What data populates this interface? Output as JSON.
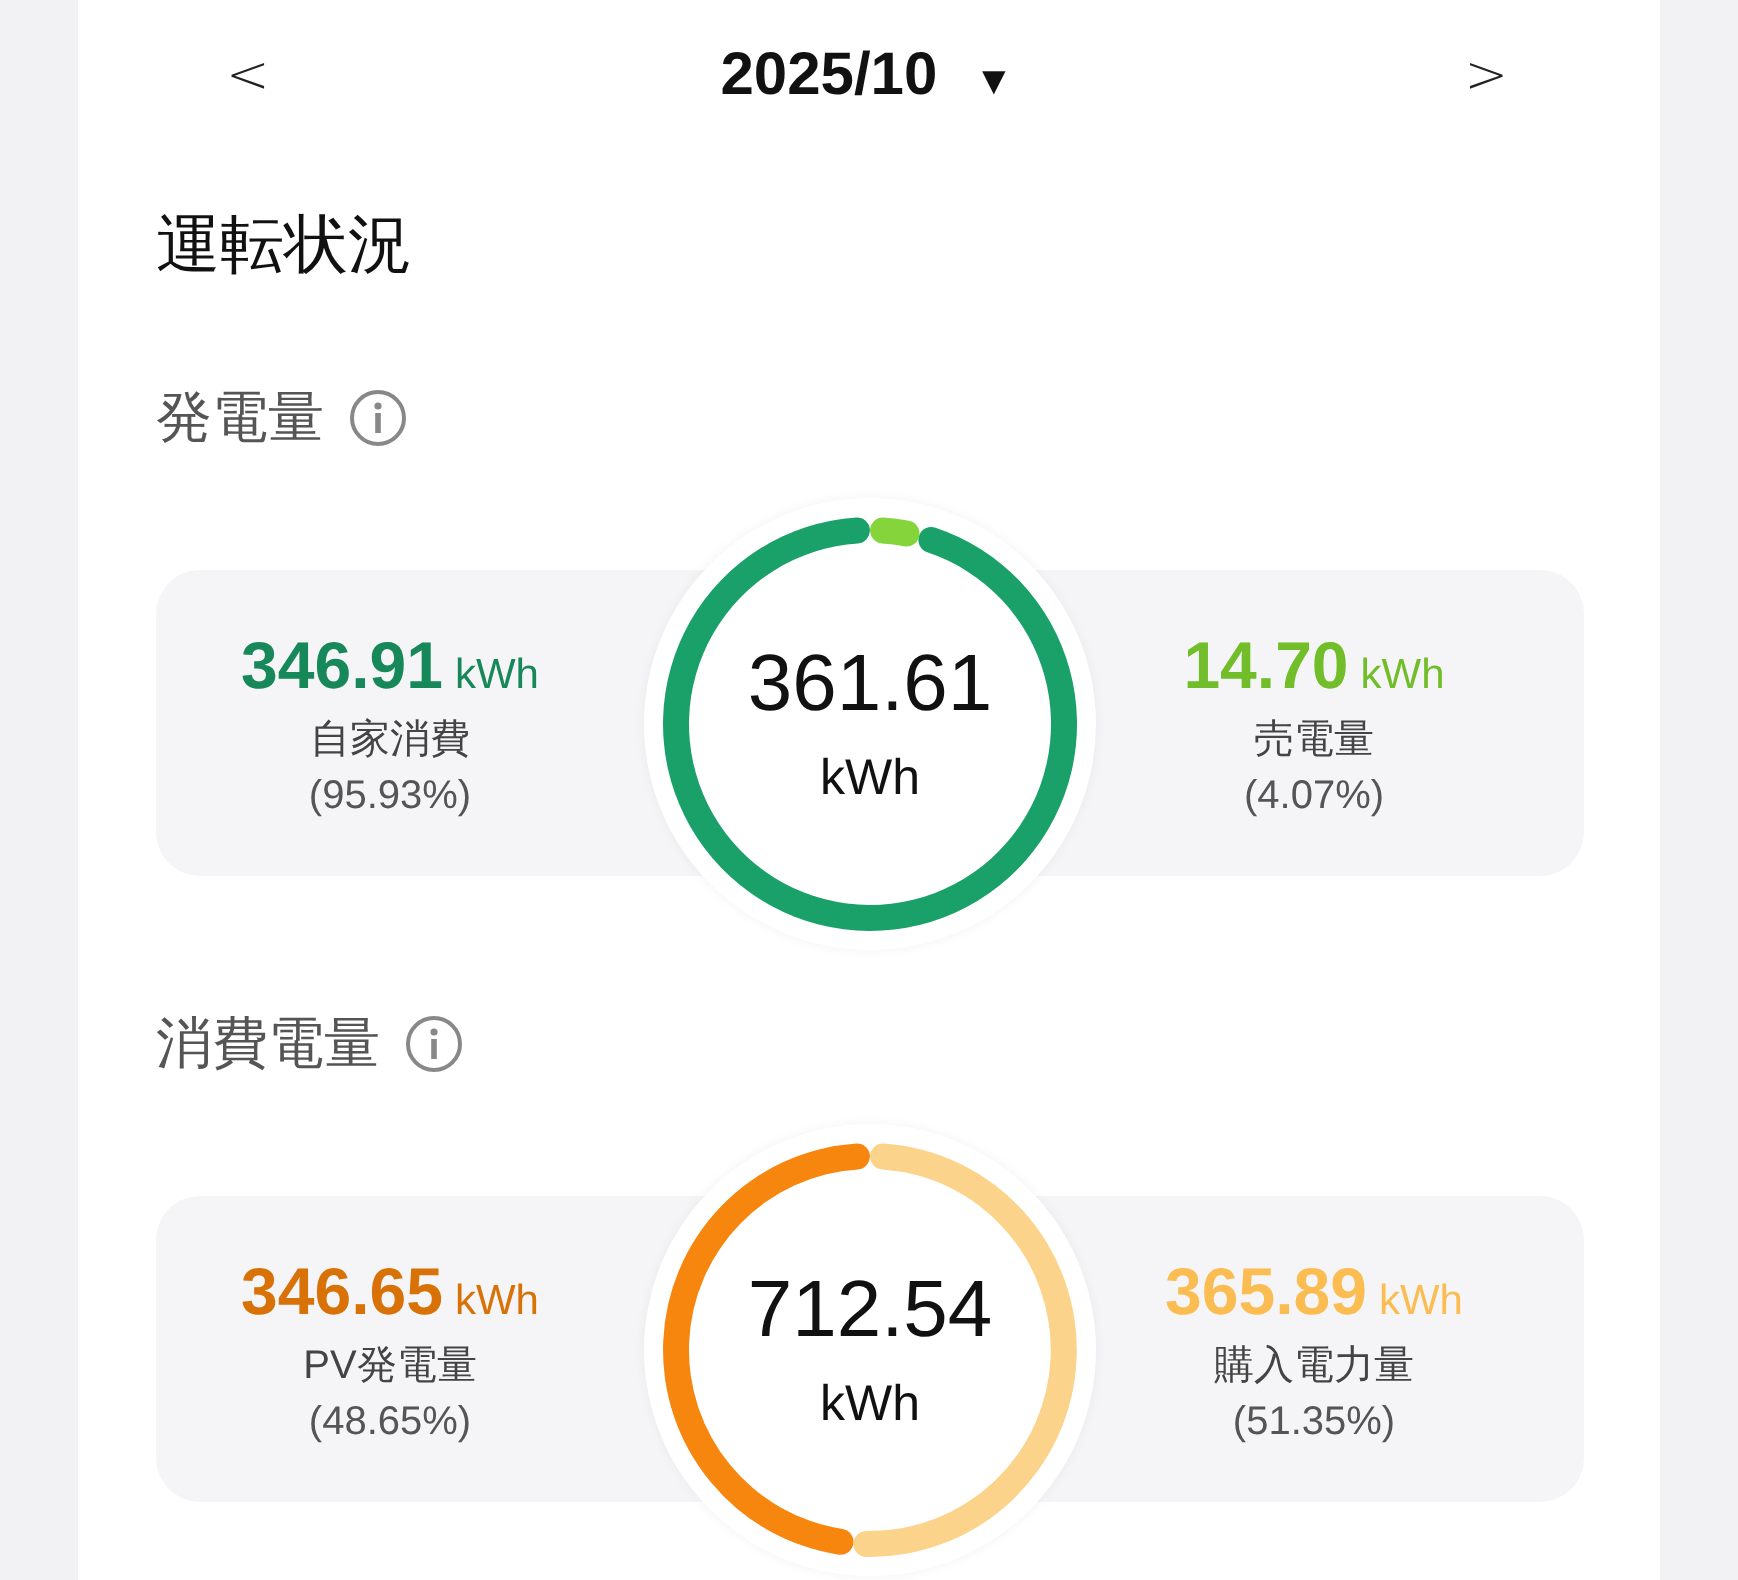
{
  "header": {
    "prev": "<",
    "title": "2025/10",
    "caret": "▼",
    "next": ">"
  },
  "section_title": "運転状況",
  "panels": [
    {
      "heading": "発電量",
      "total": "361.61",
      "total_unit": "kWh",
      "stats": [
        {
          "value": "346.91",
          "unit": "kWh",
          "label": "自家消費",
          "percent": "(95.93%)",
          "color": "#1aa069"
        },
        {
          "value": "14.70",
          "unit": "kWh",
          "label": "売電量",
          "percent": "(4.07%)",
          "color": "#86d43c"
        }
      ],
      "chart_data": {
        "type": "donut",
        "values": [
          95.93,
          4.07
        ]
      }
    },
    {
      "heading": "消費電量",
      "total": "712.54",
      "total_unit": "kWh",
      "stats": [
        {
          "value": "346.65",
          "unit": "kWh",
          "label": "PV発電量",
          "percent": "(48.65%)",
          "color": "#f7860f"
        },
        {
          "value": "365.89",
          "unit": "kWh",
          "label": "購入電力量",
          "percent": "(51.35%)",
          "color": "#fcd38a"
        }
      ],
      "chart_data": {
        "type": "donut",
        "values": [
          48.65,
          51.35
        ]
      }
    }
  ]
}
